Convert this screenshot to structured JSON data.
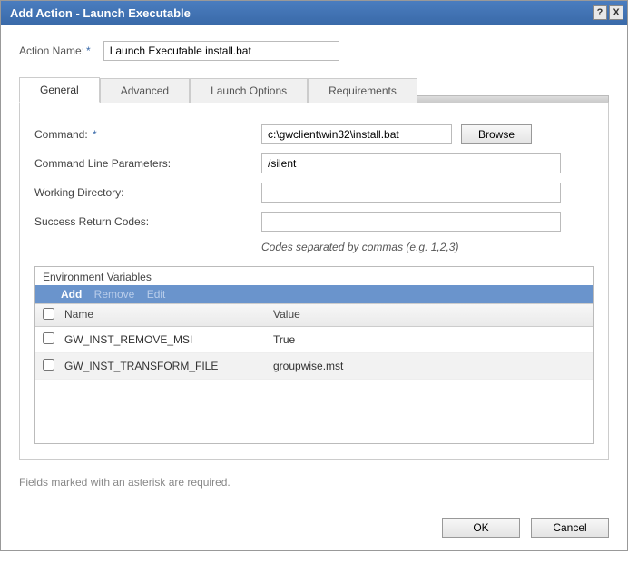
{
  "titlebar": {
    "title": "Add Action - Launch Executable",
    "help": "?",
    "close": "X"
  },
  "top": {
    "action_name_label": "Action Name:",
    "asterisk": "*",
    "action_name_value": "Launch Executable install.bat"
  },
  "tabs": {
    "general": "General",
    "advanced": "Advanced",
    "launch_options": "Launch Options",
    "requirements": "Requirements"
  },
  "general": {
    "command_label": "Command:",
    "command_value": "c:\\gwclient\\win32\\install.bat",
    "browse": "Browse",
    "params_label": "Command Line Parameters:",
    "params_value": "/silent",
    "workdir_label": "Working Directory:",
    "workdir_value": "",
    "success_label": "Success Return Codes:",
    "success_value": "",
    "codes_hint": "Codes separated by commas (e.g. 1,2,3)"
  },
  "env": {
    "section_title": "Environment Variables",
    "add": "Add",
    "remove": "Remove",
    "edit": "Edit",
    "col_name": "Name",
    "col_value": "Value",
    "rows": [
      {
        "name": "GW_INST_REMOVE_MSI",
        "value": "True"
      },
      {
        "name": "GW_INST_TRANSFORM_FILE",
        "value": "groupwise.mst"
      }
    ]
  },
  "footer": {
    "required_note": "Fields marked with an asterisk are required.",
    "ok": "OK",
    "cancel": "Cancel"
  }
}
